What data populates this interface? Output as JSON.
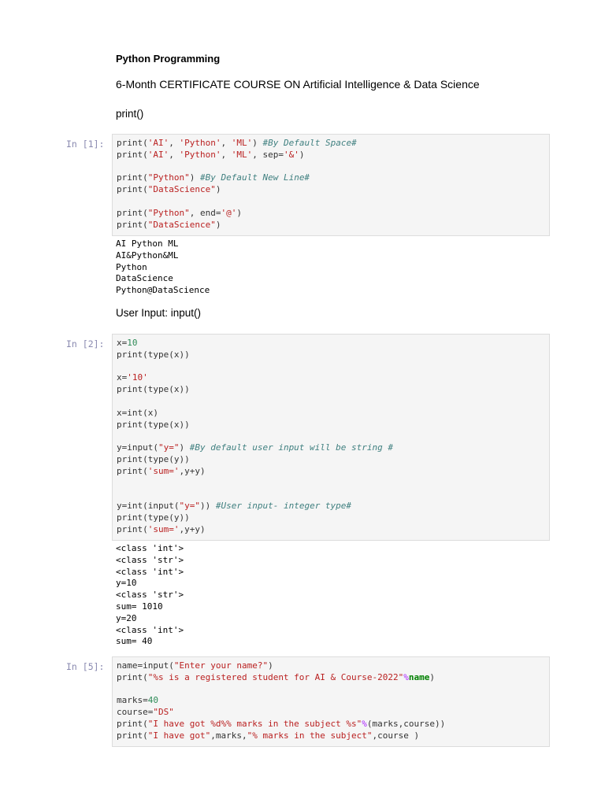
{
  "markdown": {
    "title": "Python Programming",
    "subtitle": "6-Month CERTIFICATE COURSE ON Artificial Intelligence & Data Science",
    "print_heading": "print()",
    "input_heading": "User Input: input()"
  },
  "cells": [
    {
      "prompt": "In [1]:",
      "lines": [
        [
          [
            "plain",
            "print("
          ],
          [
            "str",
            "'AI'"
          ],
          [
            "plain",
            ", "
          ],
          [
            "str",
            "'Python'"
          ],
          [
            "plain",
            ", "
          ],
          [
            "str",
            "'ML'"
          ],
          [
            "plain",
            ") "
          ],
          [
            "com",
            "#By Default Space#"
          ]
        ],
        [
          [
            "plain",
            "print("
          ],
          [
            "str",
            "'AI'"
          ],
          [
            "plain",
            ", "
          ],
          [
            "str",
            "'Python'"
          ],
          [
            "plain",
            ", "
          ],
          [
            "str",
            "'ML'"
          ],
          [
            "plain",
            ", sep="
          ],
          [
            "str",
            "'&'"
          ],
          [
            "plain",
            ")"
          ]
        ],
        [],
        [
          [
            "plain",
            "print("
          ],
          [
            "str",
            "\"Python\""
          ],
          [
            "plain",
            ") "
          ],
          [
            "com",
            "#By Default New Line#"
          ]
        ],
        [
          [
            "plain",
            "print("
          ],
          [
            "str",
            "\"DataScience\""
          ],
          [
            "plain",
            ")"
          ]
        ],
        [],
        [
          [
            "plain",
            "print("
          ],
          [
            "str",
            "\"Python\""
          ],
          [
            "plain",
            ", end="
          ],
          [
            "str",
            "'@'"
          ],
          [
            "plain",
            ")"
          ]
        ],
        [
          [
            "plain",
            "print("
          ],
          [
            "str",
            "\"DataScience\""
          ],
          [
            "plain",
            ")"
          ]
        ]
      ],
      "output": [
        "AI Python ML",
        "AI&Python&ML",
        "Python",
        "DataScience",
        "Python@DataScience"
      ]
    },
    {
      "prompt": "In [2]:",
      "lines": [
        [
          [
            "plain",
            "x="
          ],
          [
            "num",
            "10"
          ]
        ],
        [
          [
            "plain",
            "print(type(x))"
          ]
        ],
        [],
        [
          [
            "plain",
            "x="
          ],
          [
            "str",
            "'10'"
          ]
        ],
        [
          [
            "plain",
            "print(type(x))"
          ]
        ],
        [],
        [
          [
            "plain",
            "x=int(x)"
          ]
        ],
        [
          [
            "plain",
            "print(type(x))"
          ]
        ],
        [],
        [
          [
            "plain",
            "y=input("
          ],
          [
            "str",
            "\"y=\""
          ],
          [
            "plain",
            ") "
          ],
          [
            "com",
            "#By default user input will be string #"
          ]
        ],
        [
          [
            "plain",
            "print(type(y))"
          ]
        ],
        [
          [
            "plain",
            "print("
          ],
          [
            "str",
            "'sum='"
          ],
          [
            "plain",
            ",y+y)"
          ]
        ],
        [],
        [],
        [
          [
            "plain",
            "y=int(input("
          ],
          [
            "str",
            "\"y=\""
          ],
          [
            "plain",
            ")) "
          ],
          [
            "com",
            "#User input- integer type#"
          ]
        ],
        [
          [
            "plain",
            "print(type(y))"
          ]
        ],
        [
          [
            "plain",
            "print("
          ],
          [
            "str",
            "'sum='"
          ],
          [
            "plain",
            ",y+y)"
          ]
        ]
      ],
      "output": [
        "<class 'int'>",
        "<class 'str'>",
        "<class 'int'>",
        "y=10",
        "<class 'str'>",
        "sum= 1010",
        "y=20",
        "<class 'int'>",
        "sum= 40"
      ]
    },
    {
      "prompt": "In [5]:",
      "lines": [
        [
          [
            "plain",
            "name=input("
          ],
          [
            "str",
            "\"Enter your name?\""
          ],
          [
            "plain",
            ")"
          ]
        ],
        [
          [
            "plain",
            "print("
          ],
          [
            "str",
            "\"%s is a registered student for AI & Course-2022\""
          ],
          [
            "op",
            "%"
          ],
          [
            "kw",
            "name"
          ],
          [
            "plain",
            ")"
          ]
        ],
        [],
        [
          [
            "plain",
            "marks="
          ],
          [
            "num",
            "40"
          ]
        ],
        [
          [
            "plain",
            "course="
          ],
          [
            "str",
            "\"DS\""
          ]
        ],
        [
          [
            "plain",
            "print("
          ],
          [
            "str",
            "\"I have got %d%% marks in the subject %s\""
          ],
          [
            "op",
            "%"
          ],
          [
            "plain",
            "(marks,course))"
          ]
        ],
        [
          [
            "plain",
            "print("
          ],
          [
            "str",
            "\"I have got\""
          ],
          [
            "plain",
            ",marks,"
          ],
          [
            "str",
            "\"% marks in the subject\""
          ],
          [
            "plain",
            ",course )"
          ]
        ]
      ],
      "output": []
    }
  ]
}
